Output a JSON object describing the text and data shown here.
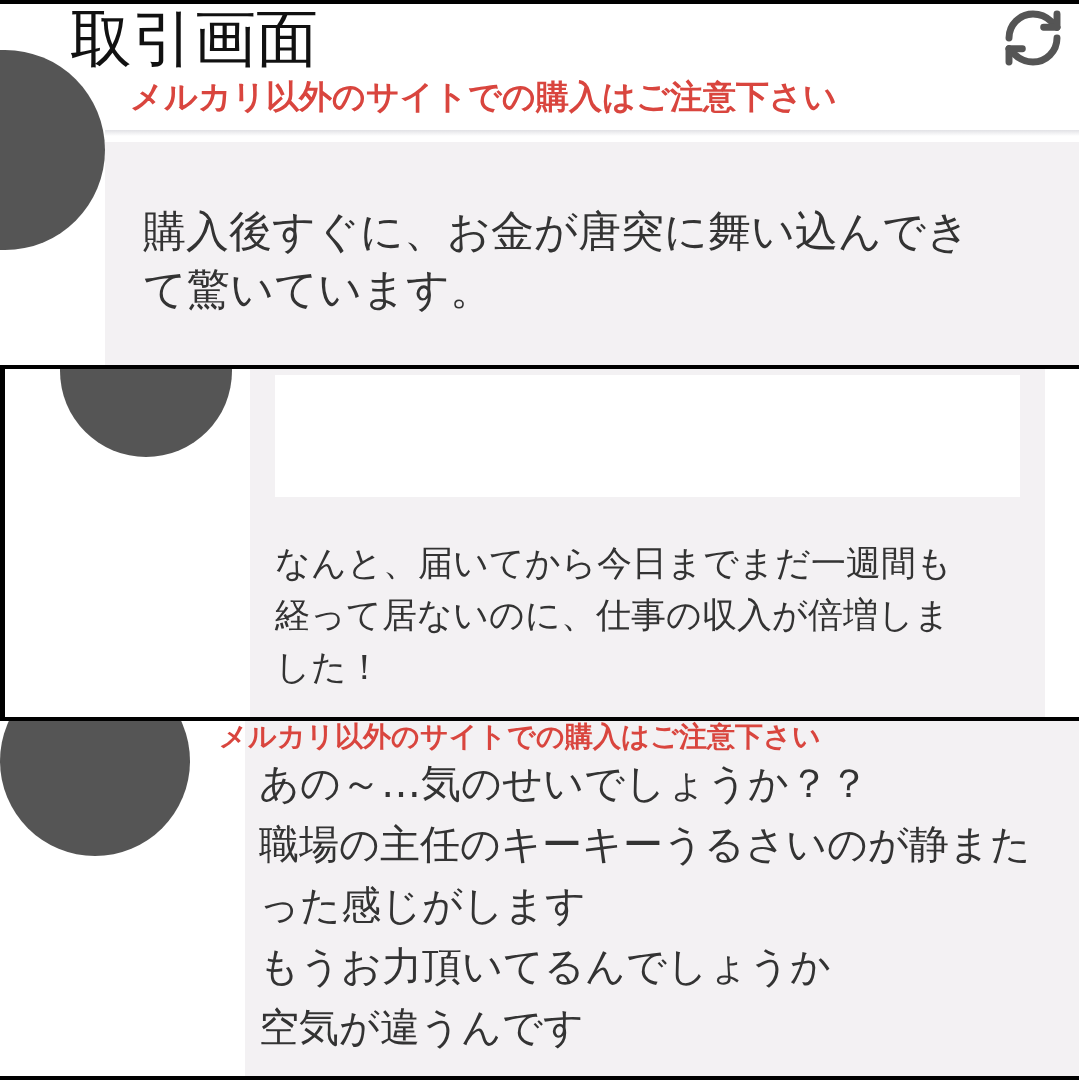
{
  "panels": [
    {
      "kind": "header",
      "title": "取引画面",
      "warning": "メルカリ以外のサイトでの購入はご注意下さい",
      "message": {
        "lines": [
          "購入後すぐに、お金が唐突に舞い込んでき",
          "て驚いています。"
        ]
      }
    },
    {
      "kind": "redacted",
      "message": {
        "lines": [
          "なんと、届いてから今日までまだ一週間も",
          "経って居ないのに、仕事の収入が倍増しま",
          "した！"
        ]
      }
    },
    {
      "kind": "warned",
      "warning": "メルカリ以外のサイトでの購入はご注意下さい",
      "message": {
        "lines": [
          "あの～…気のせいでしょうか？？",
          "職場の主任のキーキーうるさいのが静また",
          "った感じがします",
          "もうお力頂いてるんでしょうか",
          "空気が違うんです"
        ]
      }
    }
  ]
}
